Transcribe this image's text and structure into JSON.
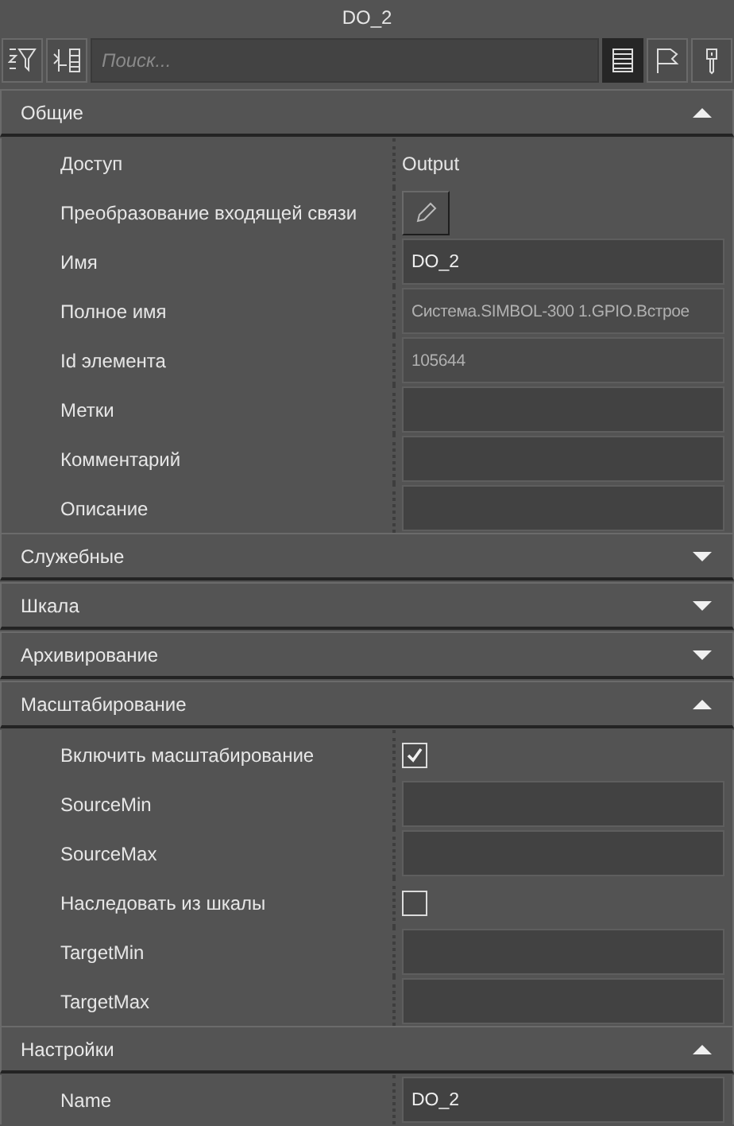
{
  "window": {
    "title": "DO_2"
  },
  "toolbar": {
    "left_buttons": [
      {
        "kind": "sort"
      },
      {
        "kind": "expand"
      }
    ],
    "search": {
      "placeholder": "Поиск..."
    },
    "view_buttons": [
      {
        "kind": "list",
        "selected": true
      },
      {
        "kind": "flag",
        "selected": false
      },
      {
        "kind": "pin",
        "selected": false
      }
    ]
  },
  "sections": [
    {
      "title": "Общие",
      "expanded": true,
      "rows": [
        {
          "label": "Доступ",
          "kind": "text",
          "value": "Output"
        },
        {
          "label": "Преобразование входящей связи",
          "kind": "edit"
        },
        {
          "label": "Имя",
          "kind": "field",
          "value": "DO_2",
          "disabled": false
        },
        {
          "label": "Полное имя",
          "kind": "field",
          "value": "Система.SIMBOL-300 1.GPIO.Встрое",
          "disabled": true
        },
        {
          "label": "Id элемента",
          "kind": "field",
          "value": "105644",
          "disabled": true
        },
        {
          "label": "Метки",
          "kind": "field",
          "disabled": false
        },
        {
          "label": "Комментарий",
          "kind": "field",
          "disabled": false
        },
        {
          "label": "Описание",
          "kind": "field",
          "disabled": false
        }
      ]
    },
    {
      "title": "Служебные",
      "expanded": false
    },
    {
      "title": "Шкала",
      "expanded": false
    },
    {
      "title": "Архивирование",
      "expanded": false
    },
    {
      "title": "Масштабирование",
      "expanded": true,
      "rows": [
        {
          "label": "Включить масштабирование",
          "kind": "checkbox",
          "checked": true
        },
        {
          "label": "SourceMin",
          "kind": "field",
          "disabled": false
        },
        {
          "label": "SourceMax",
          "kind": "field",
          "disabled": false
        },
        {
          "label": "Наследовать из шкалы",
          "kind": "checkbox",
          "checked": false
        },
        {
          "label": "TargetMin",
          "kind": "field",
          "disabled": false
        },
        {
          "label": "TargetMax",
          "kind": "field",
          "disabled": false
        }
      ]
    },
    {
      "title": "Настройки",
      "expanded": true,
      "rows": [
        {
          "label": "Name",
          "kind": "field",
          "value": "DO_2",
          "disabled": false
        }
      ]
    }
  ]
}
